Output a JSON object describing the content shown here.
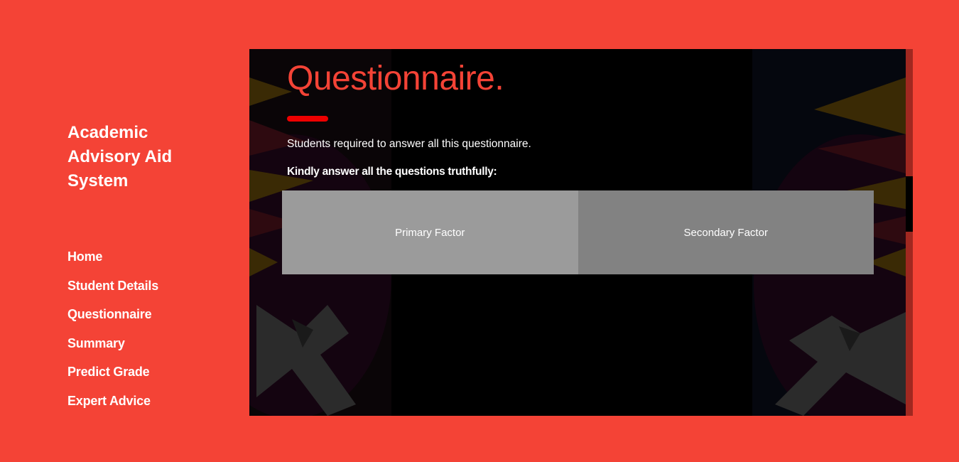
{
  "sidebar": {
    "brand": "Academic Advisory Aid System",
    "nav": [
      {
        "label": "Home"
      },
      {
        "label": "Student Details"
      },
      {
        "label": "Questionnaire"
      },
      {
        "label": "Summary"
      },
      {
        "label": "Predict Grade"
      },
      {
        "label": "Expert Advice"
      }
    ]
  },
  "main": {
    "title": "Questionnaire.",
    "intro": "Students required to answer all this questionnaire.",
    "instruction": "Kindly answer all the questions truthfully:",
    "factors": [
      {
        "label": "Primary Factor"
      },
      {
        "label": "Secondary Factor"
      }
    ]
  },
  "colors": {
    "accent": "#f44336",
    "panel_bg": "#000000",
    "primary_factor_bg": "#9b9b9b",
    "secondary_factor_bg": "#828282"
  }
}
